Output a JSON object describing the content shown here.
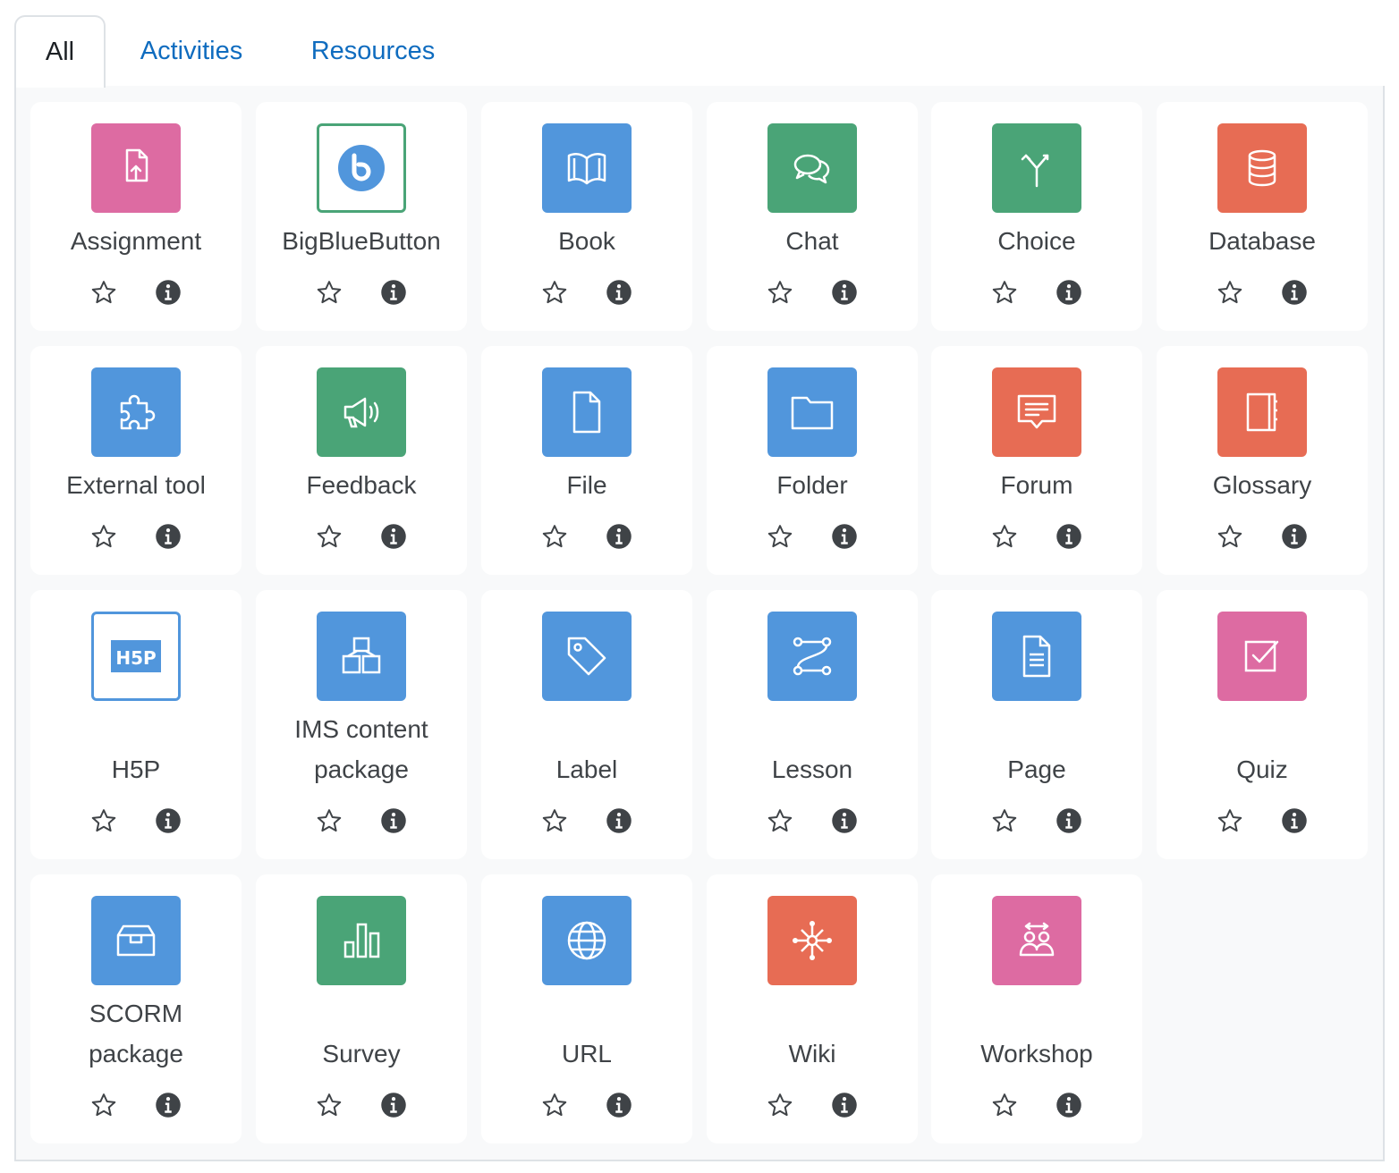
{
  "tabs": [
    {
      "label": "All",
      "active": true
    },
    {
      "label": "Activities",
      "active": false
    },
    {
      "label": "Resources",
      "active": false
    }
  ],
  "colors": {
    "link": "#0f6cbf",
    "pink": "#dd6ba2",
    "blue": "#5196dc",
    "green": "#4aa477",
    "red": "#e76c54"
  },
  "modules": [
    {
      "name": "Assignment",
      "icon": "assignment-icon",
      "color": "pink"
    },
    {
      "name": "BigBlueButton",
      "icon": "bigbluebutton-icon",
      "color": "outline-green"
    },
    {
      "name": "Book",
      "icon": "book-icon",
      "color": "blue"
    },
    {
      "name": "Chat",
      "icon": "chat-icon",
      "color": "green"
    },
    {
      "name": "Choice",
      "icon": "choice-icon",
      "color": "green"
    },
    {
      "name": "Database",
      "icon": "database-icon",
      "color": "red"
    },
    {
      "name": "External tool",
      "icon": "puzzle-icon",
      "color": "blue"
    },
    {
      "name": "Feedback",
      "icon": "megaphone-icon",
      "color": "green"
    },
    {
      "name": "File",
      "icon": "file-icon",
      "color": "blue"
    },
    {
      "name": "Folder",
      "icon": "folder-icon",
      "color": "blue"
    },
    {
      "name": "Forum",
      "icon": "forum-icon",
      "color": "red"
    },
    {
      "name": "Glossary",
      "icon": "glossary-icon",
      "color": "red"
    },
    {
      "name": "H5P",
      "icon": "h5p-icon",
      "color": "outline-blue"
    },
    {
      "name": "IMS content package",
      "icon": "ims-package-icon",
      "color": "blue"
    },
    {
      "name": "Label",
      "icon": "tag-icon",
      "color": "blue"
    },
    {
      "name": "Lesson",
      "icon": "lesson-icon",
      "color": "blue"
    },
    {
      "name": "Page",
      "icon": "page-icon",
      "color": "blue"
    },
    {
      "name": "Quiz",
      "icon": "quiz-icon",
      "color": "pink"
    },
    {
      "name": "SCORM package",
      "icon": "scorm-icon",
      "color": "blue"
    },
    {
      "name": "Survey",
      "icon": "survey-icon",
      "color": "green"
    },
    {
      "name": "URL",
      "icon": "globe-icon",
      "color": "blue"
    },
    {
      "name": "Wiki",
      "icon": "wiki-icon",
      "color": "red"
    },
    {
      "name": "Workshop",
      "icon": "workshop-icon",
      "color": "pink"
    }
  ],
  "actions": {
    "star_icon": "star-outline-icon",
    "info_icon": "info-circle-icon"
  }
}
